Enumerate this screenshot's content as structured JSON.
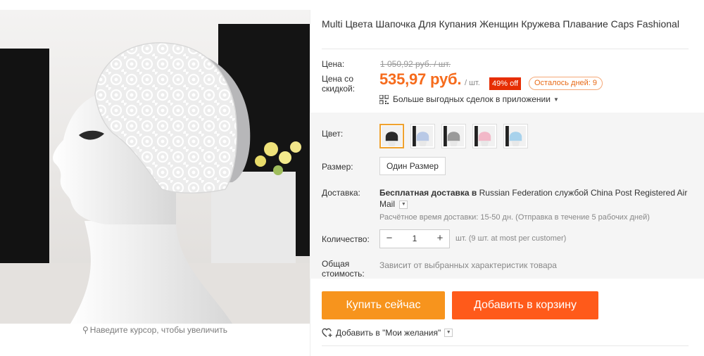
{
  "product": {
    "title": "Multi Цвета Шапочка Для Купания Женщин Кружева Плавание Caps Fashional",
    "image_hint": "Наведите курсор, чтобы увеличить",
    "image_hint_icon": "magnifier-icon"
  },
  "price": {
    "label": "Цена:",
    "original": "1 050,92 руб. / шт.",
    "discount_label": "Цена со скидкой:",
    "current": "535,97 руб.",
    "per_unit": "/ шт.",
    "discount_badge": "49% off",
    "days_left": "Осталось дней: 9",
    "app_deals": "Больше выгодных сделок в приложении",
    "badge_color": "#e62e04",
    "price_color": "#f66b1c"
  },
  "options": {
    "color_label": "Цвет:",
    "colors": [
      {
        "name": "black-lace",
        "hex": "#2a2a2a"
      },
      {
        "name": "blue-white",
        "hex": "#b9c9e6"
      },
      {
        "name": "grey-lace",
        "hex": "#9a9a9a"
      },
      {
        "name": "pink-lace",
        "hex": "#f2b8c8"
      },
      {
        "name": "light-blue",
        "hex": "#a8d2ec"
      }
    ],
    "selected_color_index": 0,
    "size_label": "Размер:",
    "size_value": "Один Размер"
  },
  "shipping": {
    "label": "Доставка:",
    "free_prefix": "Бесплатная доставка в",
    "destination": "Russian Federation",
    "via": "службой",
    "carrier": "China Post Registered Air Mail",
    "estimate": "Расчётное время доставки: 15-50 дн. (Отправка в течение 5 рабочих дней)"
  },
  "quantity": {
    "label": "Количество:",
    "value": "1",
    "minus": "−",
    "plus": "+",
    "note": "шт. (9 шт. at most per customer)"
  },
  "total": {
    "label": "Общая стоимость:",
    "value": "Зависит от выбранных характеристик товара"
  },
  "actions": {
    "buy_now": "Купить сейчас",
    "add_to_cart": "Добавить в корзину",
    "wishlist": "Добавить в \"Мои желания\"",
    "buy_color": "#f7941d",
    "cart_color": "#ff5a1a"
  }
}
